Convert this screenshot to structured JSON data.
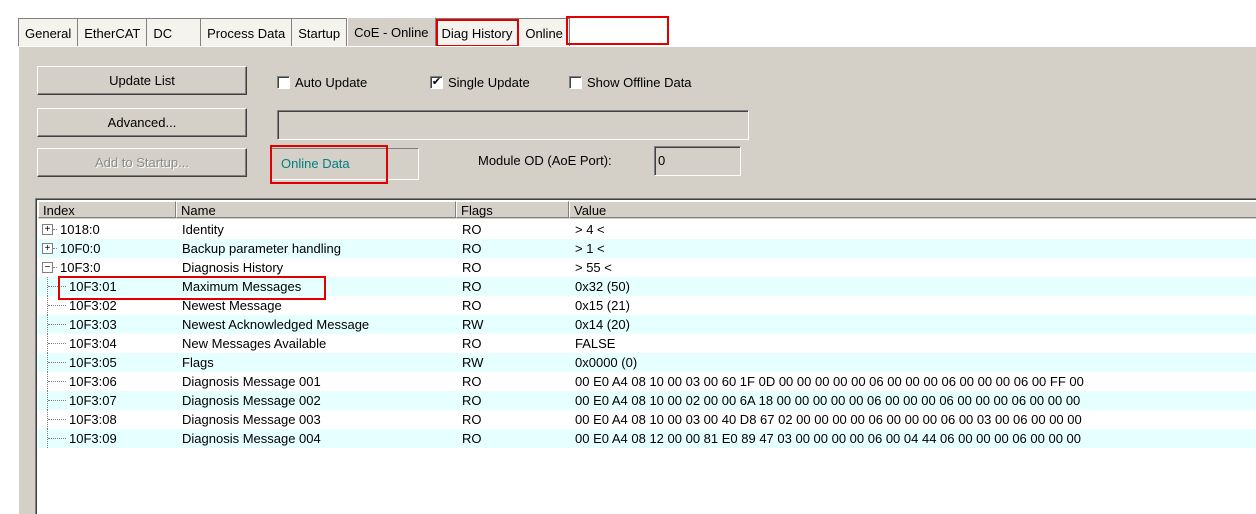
{
  "tabs": [
    {
      "label": "General",
      "name": "tab-general",
      "active": false
    },
    {
      "label": "EtherCAT",
      "name": "tab-ethercat",
      "active": false
    },
    {
      "label": "DC",
      "name": "tab-dc",
      "active": false
    },
    {
      "label": "Process Data",
      "name": "tab-process-data",
      "active": false
    },
    {
      "label": "Startup",
      "name": "tab-startup",
      "active": false
    },
    {
      "label": "CoE - Online",
      "name": "tab-coe-online",
      "active": true
    },
    {
      "label": "Diag History",
      "name": "tab-diag-history",
      "active": false
    },
    {
      "label": "Online",
      "name": "tab-online",
      "active": false
    }
  ],
  "buttons": {
    "update_list": "Update List",
    "advanced": "Advanced...",
    "add_to_startup": "Add to Startup..."
  },
  "checkboxes": {
    "auto_update": {
      "label": "Auto Update",
      "checked": false
    },
    "single_update": {
      "label": "Single Update",
      "checked": true
    },
    "show_offline": {
      "label": "Show Offline Data",
      "checked": false
    }
  },
  "status": {
    "online_data": "Online Data",
    "module_od_label": "Module OD (AoE Port):",
    "module_od_value": "0"
  },
  "table": {
    "headers": {
      "index": "Index",
      "name": "Name",
      "flags": "Flags",
      "value": "Value"
    },
    "rows": [
      {
        "index": "1018:0",
        "name": "Identity",
        "flags": "RO",
        "value": "> 4 <",
        "level": 0,
        "expander": "+"
      },
      {
        "index": "10F0:0",
        "name": "Backup parameter handling",
        "flags": "RO",
        "value": "> 1 <",
        "level": 0,
        "expander": "+"
      },
      {
        "index": "10F3:0",
        "name": "Diagnosis History",
        "flags": "RO",
        "value": "> 55 <",
        "level": 0,
        "expander": "−"
      },
      {
        "index": "10F3:01",
        "name": "Maximum Messages",
        "flags": "RO",
        "value": "0x32 (50)",
        "level": 1,
        "expander": ""
      },
      {
        "index": "10F3:02",
        "name": "Newest Message",
        "flags": "RO",
        "value": "0x15 (21)",
        "level": 1,
        "expander": ""
      },
      {
        "index": "10F3:03",
        "name": "Newest Acknowledged Message",
        "flags": "RW",
        "value": "0x14 (20)",
        "level": 1,
        "expander": ""
      },
      {
        "index": "10F3:04",
        "name": "New Messages Available",
        "flags": "RO",
        "value": "FALSE",
        "level": 1,
        "expander": ""
      },
      {
        "index": "10F3:05",
        "name": "Flags",
        "flags": "RW",
        "value": "0x0000 (0)",
        "level": 1,
        "expander": ""
      },
      {
        "index": "10F3:06",
        "name": "Diagnosis Message 001",
        "flags": "RO",
        "value": "00 E0 A4 08 10 00 03 00 60 1F 0D 00 00 00 00 00 06 00 00 00 06 00 00 00 06 00 FF 00",
        "level": 1,
        "expander": ""
      },
      {
        "index": "10F3:07",
        "name": "Diagnosis Message 002",
        "flags": "RO",
        "value": "00 E0 A4 08 10 00 02 00 00 6A 18 00 00 00 00 00 06 00 00 00 06 00 00 00 06 00 00 00",
        "level": 1,
        "expander": ""
      },
      {
        "index": "10F3:08",
        "name": "Diagnosis Message 003",
        "flags": "RO",
        "value": "00 E0 A4 08 10 00 03 00 40 D8 67 02 00 00 00 00 06 00 00 00 06 00 03 00 06 00 00 00",
        "level": 1,
        "expander": ""
      },
      {
        "index": "10F3:09",
        "name": "Diagnosis Message 004",
        "flags": "RO",
        "value": "00 E0 A4 08 12 00 00 81 E0 89 47 03 00 00 00 00 06 00 04 44 06 00 00 00 06 00 00 00",
        "level": 1,
        "expander": ""
      }
    ]
  }
}
